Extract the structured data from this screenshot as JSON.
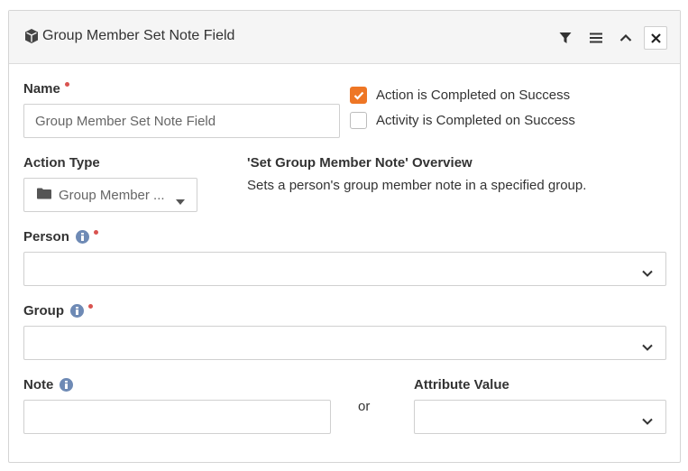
{
  "panel": {
    "title": "Group Member Set Note Field",
    "title_icon": "cube-icon"
  },
  "header_actions": [
    "filter-icon",
    "bars-icon",
    "chevron-up-icon",
    "close-icon"
  ],
  "fields": {
    "name": {
      "label": "Name",
      "value": "Group Member Set Note Field",
      "required": true
    },
    "action_completed": {
      "label": "Action is Completed on Success",
      "checked": true
    },
    "activity_completed": {
      "label": "Activity is Completed on Success",
      "checked": false
    },
    "action_type": {
      "label": "Action Type",
      "value": "Group Member ..."
    },
    "overview": {
      "title": "'Set Group Member Note' Overview",
      "description": "Sets a person's group member note in a specified group."
    },
    "person": {
      "label": "Person",
      "required": true,
      "value": ""
    },
    "group": {
      "label": "Group",
      "required": true,
      "value": ""
    },
    "note": {
      "label": "Note",
      "value": ""
    },
    "or_text": "or",
    "attribute_value": {
      "label": "Attribute Value",
      "value": ""
    }
  },
  "colors": {
    "accent": "#ee7625",
    "required": "#d9534f",
    "info": "#6e8ab5"
  }
}
